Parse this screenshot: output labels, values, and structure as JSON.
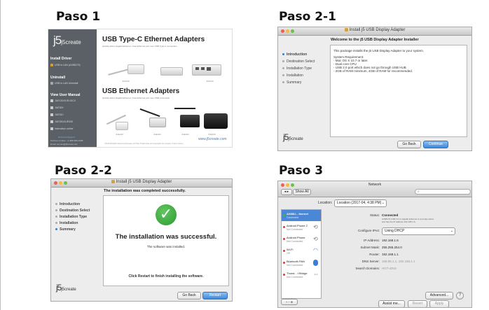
{
  "steps": [
    {
      "title": "Paso 1"
    },
    {
      "title": "Paso 2-1"
    },
    {
      "title": "Paso 2-2"
    },
    {
      "title": "Paso 3"
    }
  ],
  "step1": {
    "brand": "j5create",
    "sidebar": [
      "Install Driver",
      "Uninstall",
      "View User Manual"
    ],
    "sidebar_subitems": [
      "USB to LAN (AX88179)",
      "USB to LAN Uninstall",
      "JUE130/JUE/JUCX",
      "JUE300",
      "JUE310",
      "JUE320/JUE330",
      "Instruction online"
    ],
    "footer": [
      "Technical Support",
      "Toll-free number: +1-888-689-4088",
      "Email: service@j5create.com"
    ],
    "heading1": "USB Type-C Ethernet Adapters",
    "heading1_sub": "Quickly add a Gigabit Ethernet / Fast Ethernet port over USB Type-C connection",
    "heading2": "USB Ethernet Adapters",
    "heading2_sub": "Quickly add a Gigabit Ethernet / Fast Ethernet port over USB connection",
    "product_labels": [
      "JCE130",
      "JCE133",
      "JUE130",
      "JUE320",
      "JUE300",
      "JUE330"
    ],
    "url": "www.j5create.com",
    "copyright": "©2016 All Rights Reserved j5create. All Other Trademarks and copyrights are property of their owners."
  },
  "installer": {
    "window_title": "Install j5 USB Display Adapter",
    "brand": "j5create",
    "steps": [
      "Introduction",
      "Destination Select",
      "Installation Type",
      "Installation",
      "Summary"
    ],
    "intro_heading": "Welcome to the j5 USB Display Adapter Installer",
    "intro_text": "This package installs the j5 USB Display Adapter to your system.",
    "requirements_title": "System Requirement:",
    "requirements": [
      "- Mac OS X 10.7 or later.",
      "- Dual core CPU",
      "- USB 2.0 port which does not go through USB HUB",
      "- 2GB of RAM minimum, 4GB of RAM for recommended."
    ],
    "success_banner": "The installation was completed successfully.",
    "success_heading": "The installation was successful.",
    "success_sub": "The software was installed.",
    "restart_note": "Click Restart to finish installing the software.",
    "go_back": "Go Back",
    "continue": "Continue",
    "restart": "Restart",
    "check_symbol": "✓"
  },
  "network": {
    "window_title": "Network",
    "show_all": "Show All",
    "location_label": "Location:",
    "location_value": "Location (2017-04, 4:38 PM)",
    "interfaces": [
      {
        "name": "AX88U... thernet",
        "status": "Connected",
        "color": "#4fb04f"
      },
      {
        "name": "Android Phone 2",
        "status": "Not Connected",
        "color": "#d93b30"
      },
      {
        "name": "Android Phone",
        "status": "Not Connected",
        "color": "#d93b30"
      },
      {
        "name": "Wi-Fi",
        "status": "Off",
        "color": "#d93b30"
      },
      {
        "name": "Bluetooth PAN",
        "status": "Not Connected",
        "color": "#d93b30"
      },
      {
        "name": "Thund... t Bridge",
        "status": "Not Connected",
        "color": "#d93b30"
      }
    ],
    "fields": [
      {
        "label": "Status:",
        "value": "Connected"
      },
      {
        "label": "",
        "value": "AX88179 USB 3.0 to Gigabit Ethernet is currently active and has the IP address 192.168.1.6."
      },
      {
        "label": "Configure IPv4:",
        "value": "Using DHCP"
      },
      {
        "label": "IP Address:",
        "value": "192.168.1.6"
      },
      {
        "label": "Subnet Mask:",
        "value": "255.255.254.0"
      },
      {
        "label": "Router:",
        "value": "192.168.1.1"
      },
      {
        "label": "DNS Server:",
        "value": "168.95.1.1, 192.168.1.1"
      },
      {
        "label": "Search Domains:",
        "value": "HGT-4915"
      }
    ],
    "advanced": "Advanced...",
    "help": "?",
    "assist": "Assist me...",
    "revert": "Revert",
    "apply": "Apply",
    "add_remove": "+  −  ✲"
  },
  "colors": {
    "installer_bg": "#ededed",
    "sidebar_bg": "#e4e4e4",
    "step1_sidebar": "#5a6066",
    "success_green": "#3fab3f",
    "selected_blue": "#4a87d6"
  }
}
